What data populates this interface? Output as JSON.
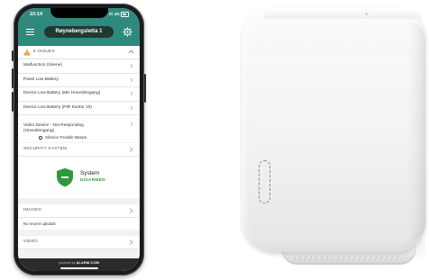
{
  "phone": {
    "status_time": "10:14",
    "status_right": "ıll 4G",
    "site_name": "Røynebergsletta 1",
    "issues": {
      "title": "5 ISSUES",
      "items": [
        {
          "label": "Malfunction (Sirene)"
        },
        {
          "label": "Panel Low Battery"
        },
        {
          "label": "Device Low Battery (MK Hovedinngang)"
        },
        {
          "label": "Device Low Battery (PIR Kontor 10)"
        },
        {
          "label": "Video Device - Not Responding\n(Hovedinngang)"
        }
      ],
      "silence_label": "Silence Trouble Beeps"
    },
    "security": {
      "title": "SECURITY SYSTEM",
      "system_label": "System",
      "state": "DISARMED"
    },
    "images": {
      "title": "IMAGES",
      "empty_text": "No recent uploads"
    },
    "video": {
      "title": "VIDEO"
    },
    "footer": {
      "powered_by": "powered by",
      "brand": "ALARM.COM"
    }
  },
  "colors": {
    "header_teal": "#2f8a7d",
    "site_pill": "#1f3a34",
    "warning_orange": "#f0932b",
    "shield_green": "#2f9a3d",
    "disarmed_green": "#2f9a3d"
  },
  "icons": [
    "menu-icon",
    "gear-icon",
    "warning-icon",
    "chevron-up-icon",
    "chevron-right-icon",
    "shield-icon"
  ]
}
